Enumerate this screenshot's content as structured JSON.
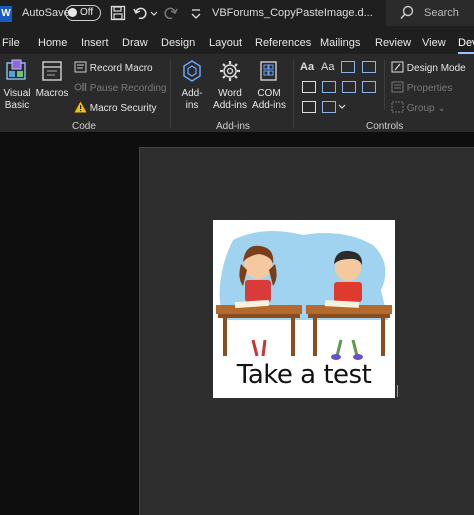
{
  "titlebar": {
    "autosave_label": "AutoSave",
    "autosave_state": "Off",
    "document_title": "VBForums_CopyPasteImage.d...",
    "search_placeholder": "Search"
  },
  "tabs": [
    {
      "label": "File"
    },
    {
      "label": "Home"
    },
    {
      "label": "Insert"
    },
    {
      "label": "Draw"
    },
    {
      "label": "Design"
    },
    {
      "label": "Layout"
    },
    {
      "label": "References"
    },
    {
      "label": "Mailings"
    },
    {
      "label": "Review"
    },
    {
      "label": "View"
    },
    {
      "label": "Dev"
    }
  ],
  "active_tab": "Developer",
  "ribbon": {
    "code": {
      "group_label": "Code",
      "visual_basic": "Visual Basic",
      "visual_basic_line1": "Visual",
      "visual_basic_line2": "Basic",
      "macros": "Macros",
      "record_macro": "Record Macro",
      "pause_recording": "Pause Recording",
      "macro_security": "Macro Security"
    },
    "addins": {
      "group_label": "Add-ins",
      "addins_line1": "Add-",
      "addins_line2": "ins",
      "word_addins_line1": "Word",
      "word_addins_line2": "Add-ins",
      "com_addins_line1": "COM",
      "com_addins_line2": "Add-ins"
    },
    "controls": {
      "group_label": "Controls",
      "design_mode": "Design Mode",
      "properties": "Properties",
      "group": "Group"
    }
  },
  "document": {
    "image_caption": "Take a test"
  },
  "colors": {
    "titlebar": "#1f1f1f",
    "ribbon": "#2a2a2a",
    "canvas": "#0e0e0e",
    "page": "#2e2e2e",
    "accent": "#9cc3ff",
    "word_blue": "#185abd"
  }
}
